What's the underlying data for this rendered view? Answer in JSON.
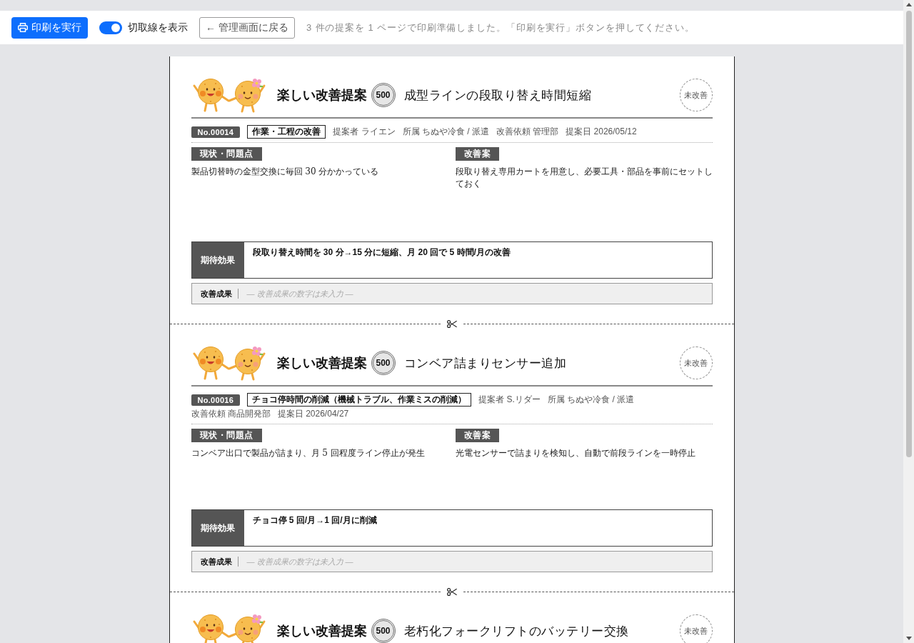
{
  "toolbar": {
    "print_button": "印刷を実行",
    "cut_line_toggle": {
      "label": "切取線を表示",
      "on": true
    },
    "back_button": "← 管理画面に戻る",
    "message": "3 件の提案を 1 ページで印刷準備しました。「印刷を実行」ボタンを押してください。"
  },
  "cards": [
    {
      "heading": "楽しい改善提案",
      "points": "500",
      "title": "成型ラインの段取り替え時間短縮",
      "status": "未改善",
      "number": "No.00014",
      "category": "作業・工程の改善",
      "meta": [
        {
          "label": "提案者",
          "value": "ライエン"
        },
        {
          "label": "所属",
          "value": "ちぬや冷食 / 派遣"
        },
        {
          "label": "改善依頼",
          "value": "管理部"
        },
        {
          "label": "提案日",
          "value": "2026/05/12"
        }
      ],
      "sections": [
        {
          "label": "現状・問題点",
          "text": "製品切替時の金型交換に毎回 30 分かかっている"
        },
        {
          "label": "改善案",
          "text": "段取り替え専用カートを用意し、必要工具・部品を事前にセットしておく"
        }
      ],
      "effect": {
        "label": "期待効果",
        "text": "段取り替え時間を 30 分→15 分に短縮、月 20 回で 5 時間/月の改善"
      },
      "result": {
        "label": "改善成果",
        "empty_text": "— 改善成果の数字は未入力 —"
      }
    },
    {
      "heading": "楽しい改善提案",
      "points": "500",
      "title": "コンベア詰まりセンサー追加",
      "status": "未改善",
      "number": "No.00016",
      "category": "チョコ停時間の削減（機械トラブル、作業ミスの削減）",
      "meta": [
        {
          "label": "提案者",
          "value": "S.リダー"
        },
        {
          "label": "所属",
          "value": "ちぬや冷食 / 派遣"
        },
        {
          "label": "改善依頼",
          "value": "商品開発部"
        },
        {
          "label": "提案日",
          "value": "2026/04/27"
        }
      ],
      "sections": [
        {
          "label": "現状・問題点",
          "text": "コンベア出口で製品が詰まり、月 5 回程度ライン停止が発生"
        },
        {
          "label": "改善案",
          "text": "光電センサーで詰まりを検知し、自動で前段ラインを一時停止"
        }
      ],
      "effect": {
        "label": "期待効果",
        "text": "チョコ停 5 回/月→1 回/月に削減"
      },
      "result": {
        "label": "改善成果",
        "empty_text": "— 改善成果の数字は未入力 —"
      }
    },
    {
      "heading": "楽しい改善提案",
      "points": "500",
      "title": "老朽化フォークリフトのバッテリー交換",
      "status": "未改善"
    }
  ]
}
